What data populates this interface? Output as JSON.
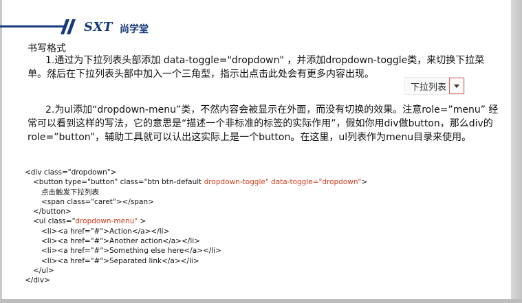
{
  "logo": {
    "brand": "SXT",
    "brand_cn": "尚学堂",
    "color": "#17397a"
  },
  "section_title": "书写格式",
  "paragraphs": {
    "p1": "1.通过为下拉列表头部添加 data-toggle=\"dropdown\" ，并添加dropdown-toggle类，来切换下拉菜单。然后在下拉列表头部中加入一个三角型，指示出点击此处会有更多内容出现。",
    "p2": "2.为ul添加“dropdown-menu”类，不然内容会被显示在外面，而没有切换的效果。注意role=”menu” 经常可以看到这样的写法，它的意思是“描述一个非标准的标签的实际作用”，假如你用div做button，那么div的role=”button”，辅助工具就可以认出这实际上是一个button。在这里，ul列表作为menu目录来使用。"
  },
  "cursor_glyph": "I",
  "demo": {
    "label": "下拉列表",
    "caret_icon": "caret-down-icon",
    "highlight_color": "#e06060"
  },
  "code": {
    "l1": "<div class=\"dropdown\">",
    "l2a": "<button type=\"button\" class=\"btn btn-default ",
    "l2b": "dropdown-toggle\"",
    "l2c": " data-toggle=\"dropdown\"",
    "l2d": ">",
    "l3": "点击触发下拉列表",
    "l4": "<span class=\"caret\"></span>",
    "l5": "</button>",
    "l6a": "<ul class=\"",
    "l6b": "dropdown-menu\"",
    "l6c": " >",
    "l7": "<li><a href=\"#\">Action</a></li>",
    "l8": "<li><a href=\"#\">Another action</a></li>",
    "l9": "<li><a href=\"#\">Something else here</a></li>",
    "l10": "<li><a href=\"#\">Separated link</a></li>",
    "l11": "</ul>",
    "l12": "</div>",
    "highlight_color": "#d23a1a"
  }
}
